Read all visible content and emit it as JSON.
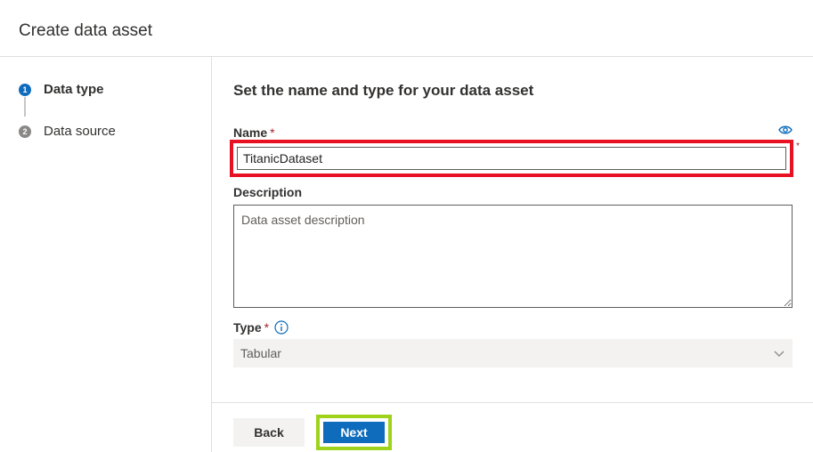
{
  "header": {
    "title": "Create data asset"
  },
  "steps": [
    {
      "number": "1",
      "label": "Data type",
      "state": "active"
    },
    {
      "number": "2",
      "label": "Data source",
      "state": "inactive"
    }
  ],
  "form": {
    "section_title": "Set the name and type for your data asset",
    "name": {
      "label": "Name",
      "required_marker": "*",
      "value": "TitanicDataset",
      "side_required_marker": "*"
    },
    "description": {
      "label": "Description",
      "placeholder": "Data asset description"
    },
    "type": {
      "label": "Type",
      "required_marker": "*",
      "selected": "Tabular"
    }
  },
  "footer": {
    "back_label": "Back",
    "next_label": "Next"
  },
  "icons": {
    "visibility": "eye-icon",
    "info": "info-icon",
    "dropdown": "chevron-down-icon"
  },
  "colors": {
    "accent": "#0f6cbd",
    "highlight_red": "#e81123",
    "highlight_green": "#9fd31b",
    "required": "#a4262c"
  }
}
